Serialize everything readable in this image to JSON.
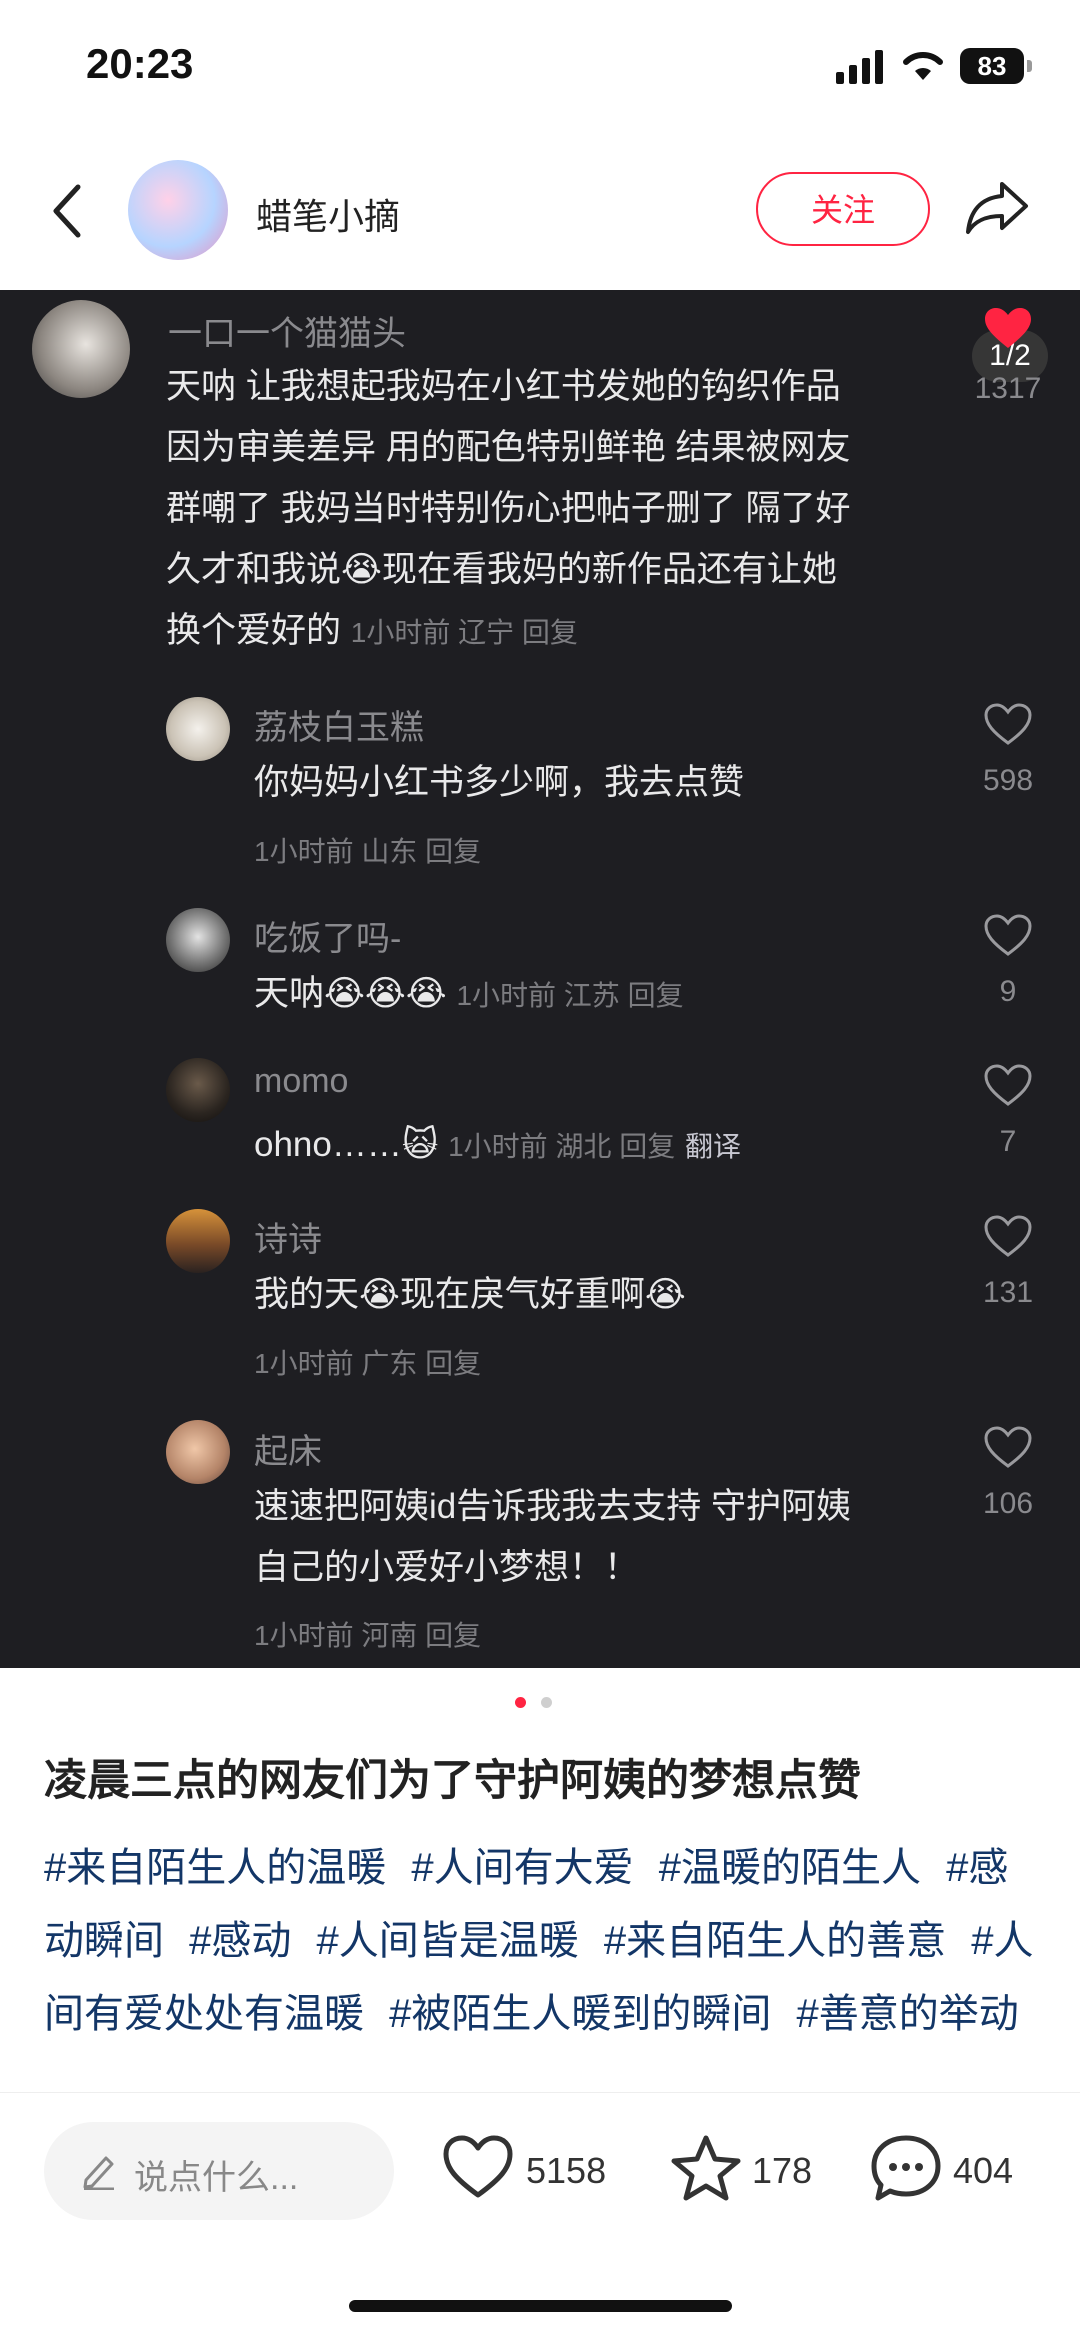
{
  "status_bar": {
    "time": "20:23",
    "battery": "83"
  },
  "header": {
    "author": "蜡笔小摘",
    "follow_label": "关注"
  },
  "image_counter": "1/2",
  "comments": [
    {
      "name": "一口一个猫猫头",
      "lines": [
        "天呐 让我想起我妈在小红书发她的钩织作品",
        "因为审美差异 用的配色特别鲜艳 结果被网友",
        "群嘲了 我妈当时特别伤心把帖子删了 隔了好",
        "久才和我说😭现在看我妈的新作品还有让她",
        "换个爱好的"
      ],
      "meta": "1小时前 辽宁 回复",
      "likes": "1317"
    },
    {
      "name": "荔枝白玉糕",
      "text": "你妈妈小红书多少啊，我去点赞",
      "meta": "1小时前 山东 回复",
      "likes": "598"
    },
    {
      "name": "吃饭了吗-",
      "text": "天呐😭😭😭",
      "meta": "1小时前 江苏 回复",
      "likes": "9"
    },
    {
      "name": "momo",
      "text": "ohno……🙀",
      "meta": "1小时前 湖北 回复",
      "translate": "翻译",
      "likes": "7"
    },
    {
      "name": "诗诗",
      "text": "我的天😭现在戾气好重啊😭",
      "meta": "1小时前 广东 回复",
      "likes": "131"
    },
    {
      "name": "起床",
      "lines": [
        "速速把阿姨id告诉我我去支持 守护阿姨",
        "自己的小爱好小梦想！！"
      ],
      "meta": "1小时前 河南 回复",
      "likes": "106"
    }
  ],
  "note": {
    "title": "凌晨三点的网友们为了守护阿姨的梦想点赞",
    "tags": [
      "#来自陌生人的温暖",
      "#人间有大爱",
      "#温暖的陌生人",
      "#感动瞬间",
      "#感动",
      "#人间皆是温暖",
      "#来自陌生人的善意",
      "#人间有爱处处有温暖",
      "#被陌生人暖到的瞬间",
      "#善意的举动"
    ]
  },
  "bottom_bar": {
    "placeholder": "说点什么...",
    "likes": "5158",
    "stars": "178",
    "comments": "404"
  },
  "colors": {
    "accent": "#ff2442",
    "tag": "#133667",
    "dark_bg": "#1e1e22"
  }
}
